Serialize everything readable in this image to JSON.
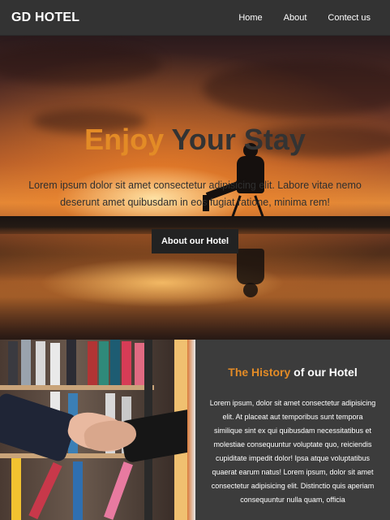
{
  "navbar": {
    "brand": "GD HOTEL",
    "links": [
      "Home",
      "About",
      "Contect us"
    ]
  },
  "hero": {
    "title_accent": "Enjoy",
    "title_rest": "Your Stay",
    "text": "Lorem ipsum dolor sit amet consectetur adipisicing elit. Labore vitae nemo deserunt amet quibusdam in eos fugiat ratione, minima rem!",
    "button_label": "About our Hotel"
  },
  "history": {
    "title_prefix": "The",
    "title_accent": "History",
    "title_suffix": "of our Hotel",
    "text": "Lorem ipsum, dolor sit amet consectetur adipisicing elit. At placeat aut temporibus sunt tempora similique sint ex qui quibusdam necessitatibus et molestiae consequuntur voluptate quo, reiciendis cupiditate impedit dolor! Ipsa atque voluptatibus quaerat earum natus! Lorem ipsum, dolor sit amet consectetur adipisicing elit. Distinctio quis aperiam consequuntur nulla quam, officia"
  },
  "colors": {
    "accent": "#e38b26",
    "navbar": "#333333",
    "section_bg": "#3c3c3c"
  }
}
